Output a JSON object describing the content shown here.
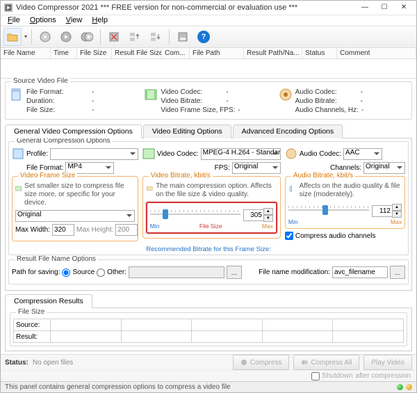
{
  "window": {
    "title": "Video Compressor 2021    *** FREE version for non-commercial or evaluation use ***"
  },
  "menu": {
    "file": "File",
    "options": "Options",
    "view": "View",
    "help": "Help"
  },
  "columns": {
    "filename": "File Name",
    "time": "Time",
    "filesize": "File Size",
    "resultsize": "Result File Size",
    "com": "Com...",
    "filepath": "File Path",
    "resultpath": "Result Path/Na...",
    "status": "Status",
    "comment": "Comment"
  },
  "source": {
    "legend": "Source Video File",
    "c1": {
      "format": "File Format:",
      "duration": "Duration:",
      "size": "File Size:",
      "v_format": "-",
      "v_duration": "-",
      "v_size": "-"
    },
    "c2": {
      "codec": "Video Codec:",
      "bitrate": "Video Bitrate:",
      "fps": "Video Frame Size, FPS:",
      "v_codec": "-",
      "v_bitrate": "-",
      "v_fps": "-"
    },
    "c3": {
      "codec": "Audio Codec:",
      "bitrate": "Audio Bitrate:",
      "ch": "Audio Channels, Hz:",
      "v_codec": "-",
      "v_bitrate": "-",
      "v_ch": "-"
    }
  },
  "tabs": {
    "general": "General Video Compression Options",
    "editing": "Video Editing Options",
    "advanced": "Advanced Encoding Options"
  },
  "general": {
    "legend": "General Compression Options",
    "profile_label": "Profile:",
    "profile_value": "",
    "fileformat_label": "File Format:",
    "fileformat_value": "MP4",
    "vfs_legend": "Video Frame Size",
    "vfs_hint": "Set smaller size to compress file size more, or specific for your device.",
    "vfs_value": "Original",
    "maxw_label": "Max Width:",
    "maxw_value": "320",
    "maxh_label": "Max Height:",
    "maxh_value": "200",
    "reco": "Recommended Bitrate for this Frame Size:",
    "vcodec_label": "Video Codec:",
    "vcodec_value": "MPEG-4 H.264 - Standar",
    "fps_label": "FPS:",
    "fps_value": "Original",
    "vbr_legend": "Video Bitrate, kbit/s",
    "vbr_hint": "The main compression option. Affects on the file size & video quality.",
    "vbr_value": "305",
    "vbr_min": "Min",
    "vbr_fs": "File Size",
    "vbr_max": "Max",
    "acodec_label": "Audio Codec:",
    "acodec_value": "AAC",
    "channels_label": "Channels:",
    "channels_value": "Original",
    "abr_legend": "Audio Bitrate, kbit/s",
    "abr_hint": "Affects on the audio quality & file size (moderately).",
    "abr_value": "112",
    "abr_min": "Min",
    "abr_max": "Max",
    "compress_audio": "Compress audio channels"
  },
  "resultname": {
    "legend": "Result File Name Options",
    "path_label": "Path for saving:",
    "source": "Source",
    "other": "Other:",
    "filemod_label": "File name modification:",
    "filemod_value": "avc_filename"
  },
  "results": {
    "legend": "Compression Results",
    "tablegend": "File Size",
    "source": "Source:",
    "result": "Result:"
  },
  "bottom": {
    "status_label": "Status:",
    "status_text": "No open files",
    "compress": "Compress",
    "compress_all": "Compress All",
    "play": "Play Video",
    "shutdown": "Shutdown",
    "after": "after compression"
  },
  "statusbar": {
    "text": "This panel contains general compression options to compress a video file"
  }
}
